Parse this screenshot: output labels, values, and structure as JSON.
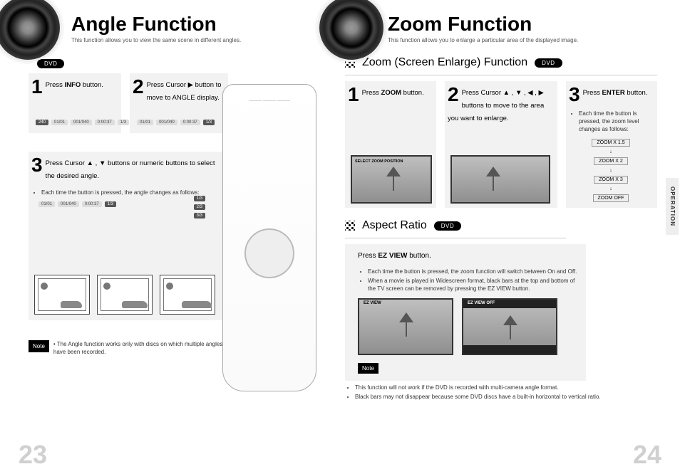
{
  "side_tab": "OPERATION",
  "badges": {
    "dvd": "DVD"
  },
  "left": {
    "page_number": "23",
    "title": "Angle Function",
    "subtitle": "This function allows you to view the same scene in different angles.",
    "step1": {
      "num": "1",
      "text_before": "Press ",
      "bold": "INFO",
      "text_after": " button."
    },
    "step2": {
      "num": "2",
      "text": "Press Cursor ▶ button to move to ANGLE display."
    },
    "step3": {
      "num": "3",
      "text": "Press Cursor ▲ , ▼  buttons or numeric buttons to select the desired angle."
    },
    "step3_note": "Each time the button is pressed, the angle changes as follows:",
    "info_chips": [
      "240",
      "01/01",
      "001/040",
      "0:00:37",
      "1/3"
    ],
    "angle_labels": [
      "1/3",
      "2/3",
      "3/3"
    ],
    "note_label": "Note",
    "note_text": "The Angle function works only with discs on which multiple angles have been recorded."
  },
  "right": {
    "page_number": "24",
    "title": "Zoom Function",
    "subtitle": "This function allows you to enlarge a particular area of the displayed image.",
    "section1_title": "Zoom (Screen Enlarge) Function",
    "z_step1": {
      "num": "1",
      "text_before": "Press ",
      "bold": "ZOOM",
      "text_after": " button.",
      "tv_caption": "SELECT ZOOM POSITION"
    },
    "z_step2": {
      "num": "2",
      "text": "Press Cursor ▲ , ▼ , ◀ , ▶  buttons to move to the area you want to enlarge."
    },
    "z_step3": {
      "num": "3",
      "text_before": "Press ",
      "bold": "ENTER",
      "text_after": " button.",
      "explain": "Each time the button is pressed, the zoom level changes as follows:",
      "levels": [
        "ZOOM X 1.5",
        "ZOOM X 2",
        "ZOOM X 3",
        "ZOOM  OFF"
      ]
    },
    "section2_title": "Aspect Ratio",
    "ezview": {
      "text_before": "Press ",
      "bold": "EZ VIEW",
      "text_after": " button."
    },
    "ez_bullets": [
      "Each time the button is pressed, the zoom function will switch between On and Off.",
      "When a movie is played in Widescreen format, black bars at the top and bottom of the TV screen can be removed by pressing the EZ VIEW button."
    ],
    "ez_on_label": "EZ VIEW",
    "ez_off_label": "EZ VIEW OFF",
    "note_label": "Note",
    "note_bullets": [
      "This function will not work if the DVD is recorded with multi-camera angle format.",
      "Black bars may not disappear because some DVD discs have a built-in horizontal to vertical ratio."
    ]
  }
}
